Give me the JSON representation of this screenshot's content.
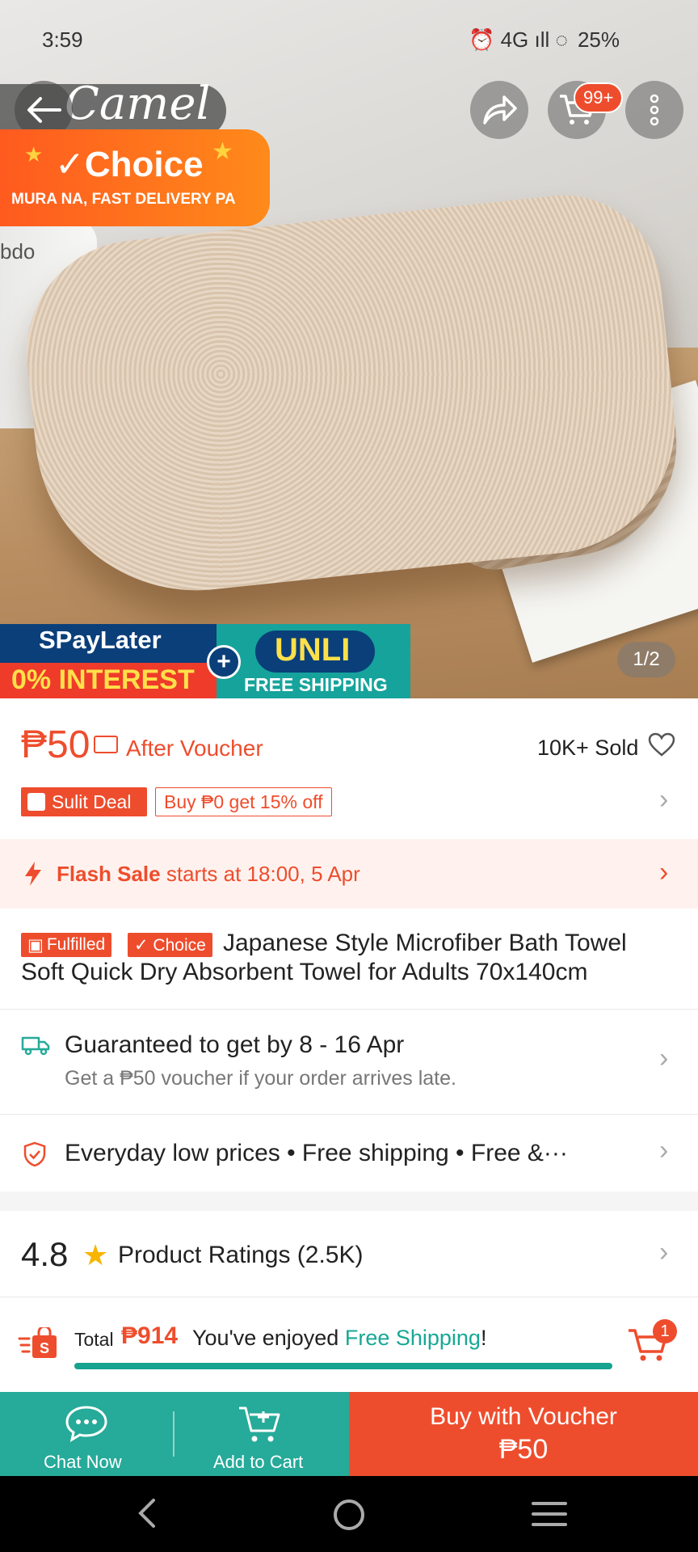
{
  "status_bar": {
    "time": "3:59",
    "right_text": "⏰ 4G ıll ◌",
    "battery": "25%"
  },
  "hero": {
    "brand_script": "Camel",
    "cart_badge": "99+",
    "choice_title": "✓Choice",
    "choice_sub": "MURA NA, FAST DELIVERY PA",
    "bdo_label": "bdo",
    "spaylater_top": "SPayLater",
    "spaylater_bottom": "0% INTEREST",
    "unli": "UNLI",
    "unli_sub": "FREE SHIPPING",
    "page_indicator": "1/2"
  },
  "price": {
    "value": "₱50",
    "after_voucher": "After Voucher",
    "sold": "10K+ Sold",
    "sulit_deal": "Sulit Deal",
    "deal_tag": "Buy ₱0 get 15% off"
  },
  "flash_sale": {
    "label": "Flash Sale",
    "text": "starts at 18:00, 5 Apr"
  },
  "product": {
    "fulfilled_tag": "Fulfilled",
    "choice_tag": "✓ Choice",
    "title_line1": "Japanese Style Microfiber Bath Towel",
    "title_line2": "Soft Quick Dry Absorbent Towel for Adults 70x140cm"
  },
  "delivery": {
    "title": "Guaranteed to get by 8 - 16 Apr",
    "subtitle": "Get a ₱50 voucher if your order arrives late."
  },
  "benefits": {
    "text": "Everyday low prices  •  Free shipping  •  Free &···"
  },
  "ratings": {
    "score": "4.8",
    "label": "Product Ratings (2.5K)"
  },
  "cart_summary": {
    "total_label": "Total",
    "total_value": "₱914",
    "enjoyed_prefix": "You've enjoyed",
    "free_shipping": "Free Shipping",
    "enjoyed_suffix": "!",
    "progress_fraction": 1.0,
    "cart_count": "1"
  },
  "actions": {
    "chat": "Chat Now",
    "add_to_cart": "Add to Cart",
    "buy_line1": "Buy with Voucher",
    "buy_line2": "₱50"
  },
  "colors": {
    "accent": "#ee4d2d",
    "teal": "#26aa99",
    "star": "#f7b500"
  }
}
